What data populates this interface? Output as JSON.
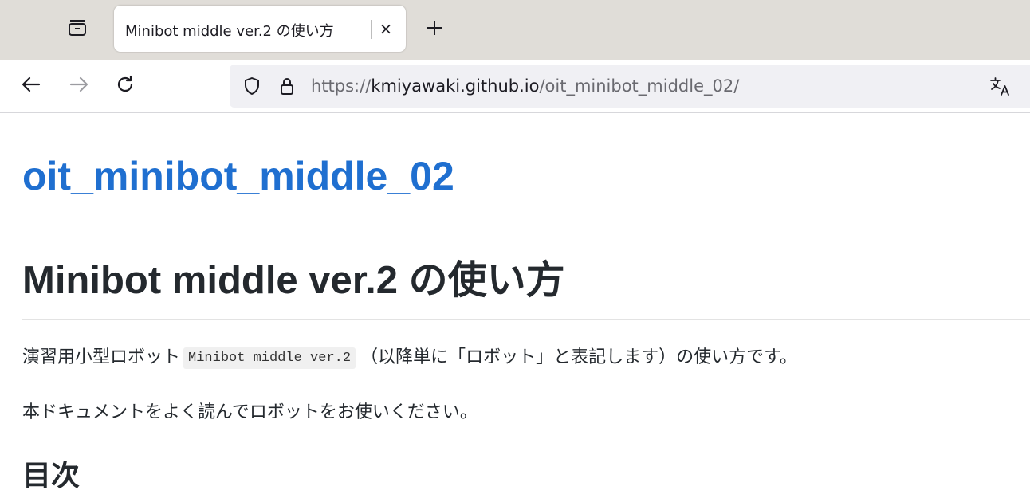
{
  "browser": {
    "tab": {
      "title": "Minibot middle ver.2 の使い方",
      "close_glyph": "×"
    },
    "new_tab_glyph": "+",
    "url": {
      "scheme": "https://",
      "host": "kmiyawaki.github.io",
      "path": "/oit_minibot_middle_02/"
    },
    "icons": {
      "tab_list": "tab-list-icon",
      "back": "back-arrow-icon",
      "forward": "forward-arrow-icon",
      "reload": "reload-icon",
      "shield": "shield-icon",
      "lock": "lock-icon",
      "translate": "translate-icon"
    }
  },
  "page": {
    "site_title": "oit_minibot_middle_02",
    "heading": "Minibot middle ver.2 の使い方",
    "intro": {
      "before": "演習用小型ロボット",
      "code": "Minibot middle ver.2",
      "after": "（以降単に「ロボット」と表記します）の使い方です。"
    },
    "note": "本ドキュメントをよく読んでロボットをお使いください。",
    "toc_heading": "目次"
  },
  "colors": {
    "link": "#1f6fd0",
    "text": "#24292e",
    "tab_strip": "#e0ddd8",
    "url_bar": "#f0f0f4"
  }
}
